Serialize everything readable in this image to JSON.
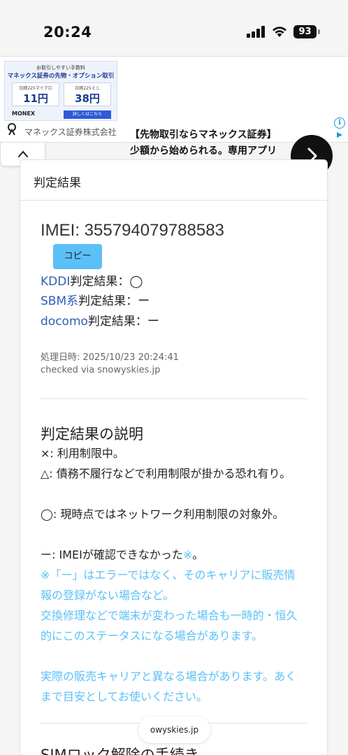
{
  "status_bar": {
    "time": "20:24",
    "battery": "93"
  },
  "ad": {
    "image_line1": "お取引しやすい手数料",
    "image_line2": "マネックス証券の先物・オプション取引",
    "box1_caption": "日経225マイクロ",
    "box1_value": "11円",
    "box2_caption": "日経225ミニ",
    "box2_value": "38円",
    "brand": "MONEX",
    "cta": "詳しくはこちら",
    "text": "【先物取引ならマネックス証券】少額から始められる。専用アプリで、スマホでどこでも先物取引。",
    "company": "マネックス証券株式会社"
  },
  "card": {
    "header": "判定結果",
    "imei": "IMEI: 355794079788583",
    "copy_label": "コピー",
    "carriers": [
      {
        "name": "KDDI",
        "result": "判定結果：◯"
      },
      {
        "name": "SBM系",
        "result": "判定結果：ー"
      },
      {
        "name": "docomo",
        "result": "判定結果：ー"
      }
    ],
    "processed_at": "処理日時: 2025/10/23 20:24:41",
    "checked_via": "checked via snowyskies.jp"
  },
  "explanation": {
    "title": "判定結果の説明",
    "cross": "×: 利用制限中。",
    "triangle": "△: 債務不履行などで利用制限が掛かる恐れ有り。",
    "circle": "◯: 現時点ではネットワーク利用制限の対象外。",
    "dash": "ー: IMEIが確認できなかった",
    "dash_mark": "※",
    "dash_end": "。",
    "note1": "※「ー」はエラーではなく、そのキャリアに販売情報の登録がない場合など。",
    "note2": "交換修理などで端末が変わった場合も一時的・恒久的にこのステータスになる場合があります。",
    "note3": "実際の販売キャリアと異なる場合があります。あくまで目安としてお使いください。"
  },
  "next_section_title": "SIMロック解除の手続き",
  "url_pill": "owyskies.jp"
}
